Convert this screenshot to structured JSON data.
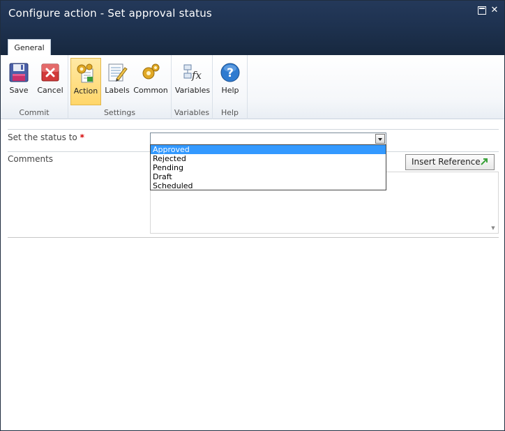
{
  "window": {
    "title": "Configure action - Set approval status"
  },
  "ribbon": {
    "tab_label": "General",
    "groups": {
      "commit": {
        "label": "Commit",
        "save_label": "Save",
        "cancel_label": "Cancel"
      },
      "settings": {
        "label": "Settings",
        "action_label": "Action",
        "labels_label": "Labels",
        "common_label": "Common"
      },
      "variables": {
        "label": "Variables",
        "variables_label": "Variables"
      },
      "help": {
        "label": "Help",
        "help_label": "Help"
      }
    }
  },
  "form": {
    "status_label": "Set the status to",
    "required_marker": "*",
    "status_value": "",
    "status_options": [
      "Approved",
      "Rejected",
      "Pending",
      "Draft",
      "Scheduled"
    ],
    "highlighted_option": "Approved",
    "comments_label": "Comments",
    "insert_reference_label": "Insert Reference",
    "comments_value": ""
  },
  "icons": {
    "save": "floppy-disk-icon",
    "cancel": "red-x-icon",
    "action": "gears-document-icon",
    "labels": "notepad-pencil-icon",
    "common": "gears-icon",
    "variables": "fx-formula-icon",
    "help": "question-mark-icon",
    "insert_reference": "green-arrow-icon"
  },
  "colors": {
    "titlebar": "#1e3250",
    "active_button": "#ffd66a",
    "selection": "#3399ff",
    "required": "#d40000"
  }
}
